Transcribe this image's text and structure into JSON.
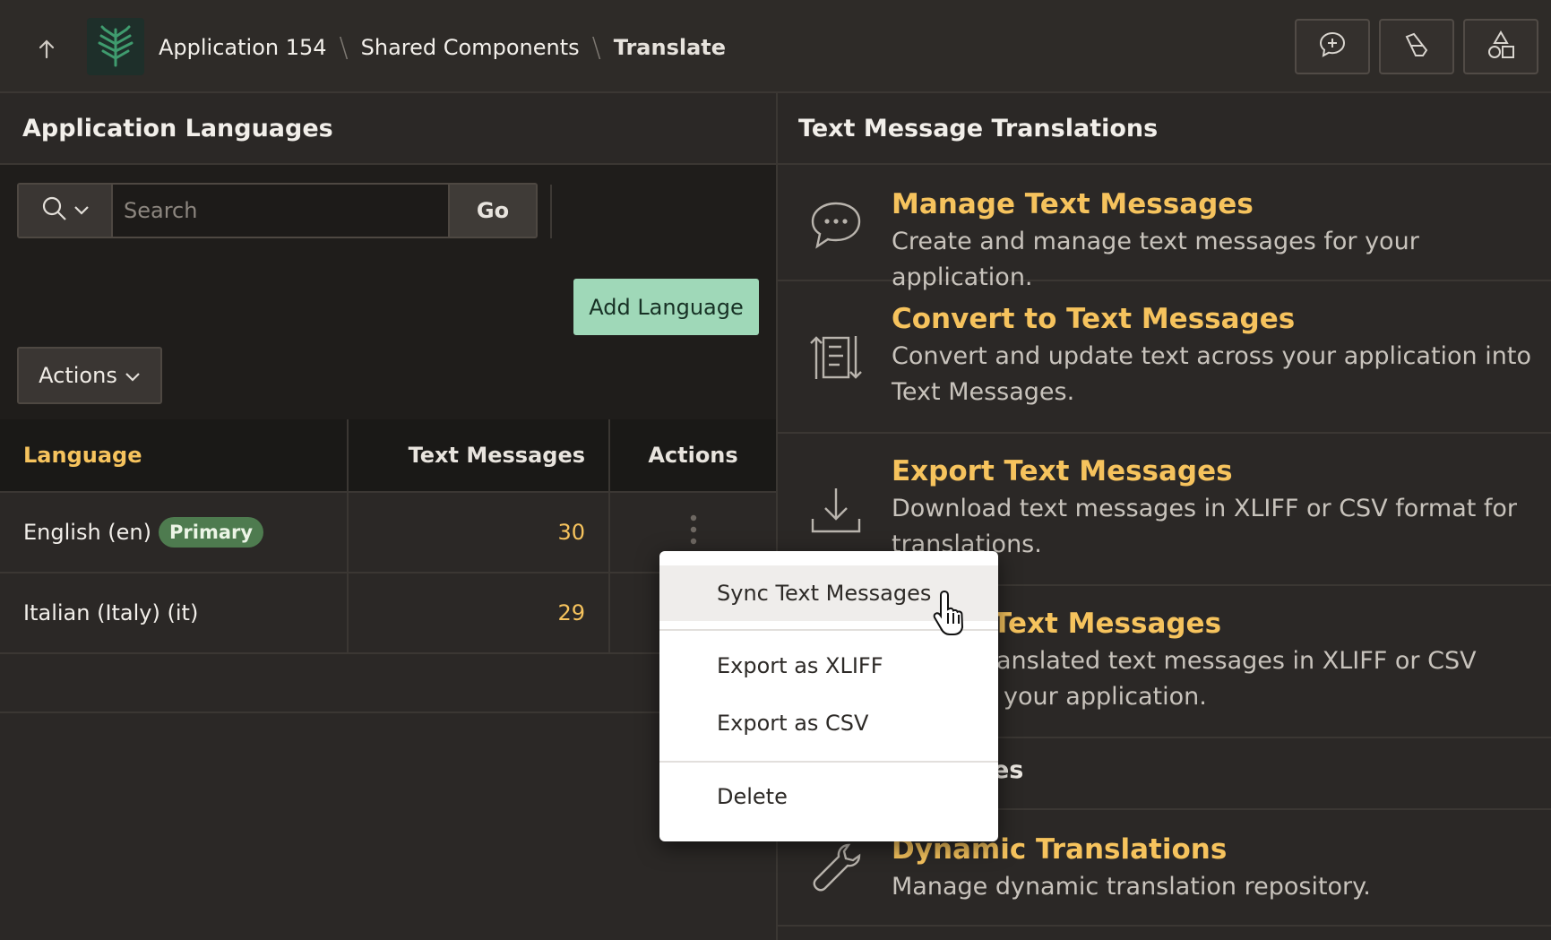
{
  "header": {
    "up_icon": "arrow-up-icon",
    "breadcrumbs": [
      "Application 154",
      "Shared Components",
      "Translate"
    ],
    "buttons": [
      "chat-add-icon",
      "pencil-eraser-icon",
      "shapes-icon"
    ]
  },
  "left": {
    "title": "Application Languages",
    "search_placeholder": "Search",
    "go_label": "Go",
    "add_language_label": "Add Language",
    "actions_label": "Actions",
    "table": {
      "columns": [
        "Language",
        "Text Messages",
        "Actions"
      ],
      "rows": [
        {
          "language": "English (en)",
          "badge": "Primary",
          "messages": "30"
        },
        {
          "language": "Italian (Italy) (it)",
          "messages": "29"
        }
      ]
    }
  },
  "right": {
    "title": "Text Message Translations",
    "cards": [
      {
        "title": "Manage Text Messages",
        "desc": "Create and manage text messages for your application.",
        "icon": "chat-bubble-icon"
      },
      {
        "title": "Convert to Text Messages",
        "desc": "Convert and update text across your application into Text Messages.",
        "icon": "convert-icon"
      },
      {
        "title": "Export Text Messages",
        "desc": "Download text messages in XLIFF or CSV format for translations.",
        "icon": "download-icon"
      },
      {
        "title": "Text Messages",
        "desc_line1": "anslated text messages in XLIFF or CSV",
        "desc_line2": "your application.",
        "icon": "upload-icon"
      },
      {
        "title": "es"
      },
      {
        "title": "Dynamic Translations",
        "desc": "Manage dynamic translation repository.",
        "icon": "wrench-icon"
      }
    ]
  },
  "menu": {
    "items": [
      "Sync Text Messages",
      "Export as XLIFF",
      "Export as CSV",
      "Delete"
    ]
  },
  "colors": {
    "accent": "#f6c35d",
    "add_button": "#9fd8b8",
    "badge": "#4e7b4f",
    "background": "#2b2826"
  }
}
